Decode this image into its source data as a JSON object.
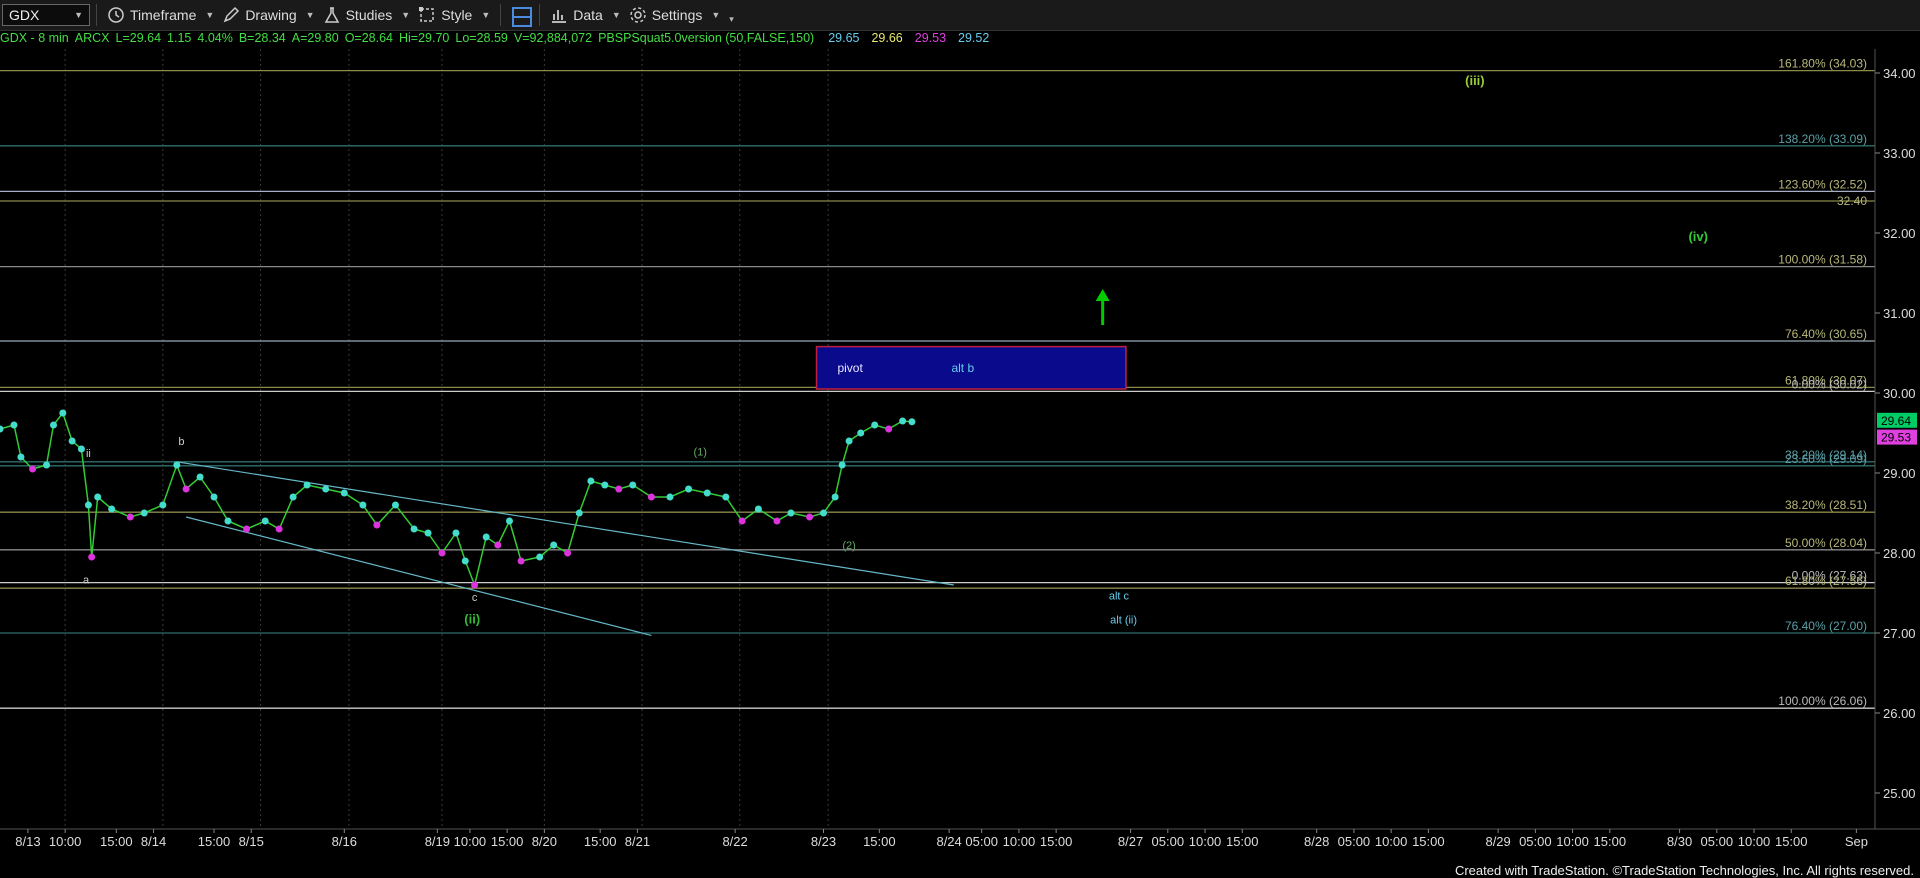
{
  "toolbar": {
    "symbol": "GDX",
    "items": [
      {
        "label": "Timeframe",
        "icon": "clock-icon"
      },
      {
        "label": "Drawing",
        "icon": "pencil-icon"
      },
      {
        "label": "Studies",
        "icon": "flask-icon"
      },
      {
        "label": "Style",
        "icon": "style-icon"
      },
      {
        "label": "",
        "icon": "layout-icon"
      },
      {
        "label": "Data",
        "icon": "bar-chart-icon"
      },
      {
        "label": "Settings",
        "icon": "gear-icon"
      }
    ]
  },
  "infobar": {
    "symbol": "GDX - 8 min",
    "exchange": "ARCX",
    "last": "L=29.64",
    "change": "1.15",
    "change_pct": "4.04%",
    "bid": "B=28.34",
    "ask": "A=29.80",
    "open": "O=28.64",
    "high": "Hi=29.70",
    "low": "Lo=28.59",
    "volume": "V=92,884,072",
    "study": "PBSPSquat5.0version (50,FALSE,150)",
    "study_values": [
      {
        "value": "29.65",
        "color": "#66ccee"
      },
      {
        "value": "29.66",
        "color": "#e8e86a"
      },
      {
        "value": "29.53",
        "color": "#e040e0"
      },
      {
        "value": "29.52",
        "color": "#66ccee"
      }
    ]
  },
  "footer": "Created with TradeStation. ©TradeStation Technologies, Inc. All rights reserved.",
  "chart_data": {
    "type": "line",
    "title": "GDX - 8 min",
    "y_axis": {
      "min": 24.55,
      "max": 34.3,
      "side": "right",
      "ticks": [
        "25.00",
        "26.00",
        "27.00",
        "28.00",
        "29.00",
        "30.00",
        "31.00",
        "32.00",
        "33.00",
        "34.00"
      ]
    },
    "x_axis": {
      "labels": [
        {
          "t": 0.6,
          "label": "8/13"
        },
        {
          "t": 1.4,
          "label": "10:00"
        },
        {
          "t": 2.5,
          "label": "15:00"
        },
        {
          "t": 3.3,
          "label": "8/14"
        },
        {
          "t": 4.6,
          "label": "15:00"
        },
        {
          "t": 5.4,
          "label": "8/15"
        },
        {
          "t": 7.4,
          "label": "8/16"
        },
        {
          "t": 9.4,
          "label": "8/19"
        },
        {
          "t": 10.1,
          "label": "10:00"
        },
        {
          "t": 10.9,
          "label": "15:00"
        },
        {
          "t": 11.7,
          "label": "8/20"
        },
        {
          "t": 12.9,
          "label": "15:00"
        },
        {
          "t": 13.7,
          "label": "8/21"
        },
        {
          "t": 15.8,
          "label": "8/22"
        },
        {
          "t": 17.7,
          "label": "8/23"
        },
        {
          "t": 18.9,
          "label": "15:00"
        },
        {
          "t": 20.4,
          "label": "8/24"
        },
        {
          "t": 21.1,
          "label": "05:00"
        },
        {
          "t": 21.9,
          "label": "10:00"
        },
        {
          "t": 22.7,
          "label": "15:00"
        },
        {
          "t": 24.3,
          "label": "8/27"
        },
        {
          "t": 25.1,
          "label": "05:00"
        },
        {
          "t": 25.9,
          "label": "10:00"
        },
        {
          "t": 26.7,
          "label": "15:00"
        },
        {
          "t": 28.3,
          "label": "8/28"
        },
        {
          "t": 29.1,
          "label": "05:00"
        },
        {
          "t": 29.9,
          "label": "10:00"
        },
        {
          "t": 30.7,
          "label": "15:00"
        },
        {
          "t": 32.2,
          "label": "8/29"
        },
        {
          "t": 33.0,
          "label": "05:00"
        },
        {
          "t": 33.8,
          "label": "10:00"
        },
        {
          "t": 34.6,
          "label": "15:00"
        },
        {
          "t": 36.1,
          "label": "8/30"
        },
        {
          "t": 36.9,
          "label": "05:00"
        },
        {
          "t": 37.7,
          "label": "10:00"
        },
        {
          "t": 38.5,
          "label": "15:00"
        },
        {
          "t": 39.9,
          "label": "Sep"
        }
      ]
    },
    "session_dividers": [
      1.4,
      3.5,
      5.6,
      7.5,
      9.5,
      11.7,
      13.8,
      15.9,
      17.8
    ],
    "price_series": [
      {
        "t": 0.0,
        "v": 29.55
      },
      {
        "t": 0.3,
        "v": 29.6
      },
      {
        "t": 0.45,
        "v": 29.2
      },
      {
        "t": 0.7,
        "v": 29.05
      },
      {
        "t": 1.0,
        "v": 29.1
      },
      {
        "t": 1.15,
        "v": 29.6
      },
      {
        "t": 1.35,
        "v": 29.75
      },
      {
        "t": 1.55,
        "v": 29.4
      },
      {
        "t": 1.75,
        "v": 29.3
      },
      {
        "t": 1.9,
        "v": 28.6
      },
      {
        "t": 1.97,
        "v": 27.95
      },
      {
        "t": 2.1,
        "v": 28.7
      },
      {
        "t": 2.4,
        "v": 28.55
      },
      {
        "t": 2.8,
        "v": 28.45
      },
      {
        "t": 3.1,
        "v": 28.5
      },
      {
        "t": 3.5,
        "v": 28.6
      },
      {
        "t": 3.8,
        "v": 29.1
      },
      {
        "t": 4.0,
        "v": 28.8
      },
      {
        "t": 4.3,
        "v": 28.95
      },
      {
        "t": 4.6,
        "v": 28.7
      },
      {
        "t": 4.9,
        "v": 28.4
      },
      {
        "t": 5.3,
        "v": 28.3
      },
      {
        "t": 5.7,
        "v": 28.4
      },
      {
        "t": 6.0,
        "v": 28.3
      },
      {
        "t": 6.3,
        "v": 28.7
      },
      {
        "t": 6.6,
        "v": 28.85
      },
      {
        "t": 7.0,
        "v": 28.8
      },
      {
        "t": 7.4,
        "v": 28.75
      },
      {
        "t": 7.8,
        "v": 28.6
      },
      {
        "t": 8.1,
        "v": 28.35
      },
      {
        "t": 8.5,
        "v": 28.6
      },
      {
        "t": 8.9,
        "v": 28.3
      },
      {
        "t": 9.2,
        "v": 28.25
      },
      {
        "t": 9.5,
        "v": 28.0
      },
      {
        "t": 9.8,
        "v": 28.25
      },
      {
        "t": 10.0,
        "v": 27.9
      },
      {
        "t": 10.2,
        "v": 27.6
      },
      {
        "t": 10.45,
        "v": 28.2
      },
      {
        "t": 10.7,
        "v": 28.1
      },
      {
        "t": 10.95,
        "v": 28.4
      },
      {
        "t": 11.2,
        "v": 27.9
      },
      {
        "t": 11.6,
        "v": 27.95
      },
      {
        "t": 11.9,
        "v": 28.1
      },
      {
        "t": 12.2,
        "v": 28.0
      },
      {
        "t": 12.45,
        "v": 28.5
      },
      {
        "t": 12.7,
        "v": 28.9
      },
      {
        "t": 13.0,
        "v": 28.85
      },
      {
        "t": 13.3,
        "v": 28.8
      },
      {
        "t": 13.6,
        "v": 28.85
      },
      {
        "t": 14.0,
        "v": 28.7
      },
      {
        "t": 14.4,
        "v": 28.7
      },
      {
        "t": 14.8,
        "v": 28.8
      },
      {
        "t": 15.2,
        "v": 28.75
      },
      {
        "t": 15.6,
        "v": 28.7
      },
      {
        "t": 15.95,
        "v": 28.4
      },
      {
        "t": 16.3,
        "v": 28.55
      },
      {
        "t": 16.7,
        "v": 28.4
      },
      {
        "t": 17.0,
        "v": 28.5
      },
      {
        "t": 17.4,
        "v": 28.45
      },
      {
        "t": 17.7,
        "v": 28.5
      },
      {
        "t": 17.95,
        "v": 28.7
      },
      {
        "t": 18.1,
        "v": 29.1
      },
      {
        "t": 18.25,
        "v": 29.4
      },
      {
        "t": 18.5,
        "v": 29.5
      },
      {
        "t": 18.8,
        "v": 29.6
      },
      {
        "t": 19.1,
        "v": 29.55
      },
      {
        "t": 19.4,
        "v": 29.65
      },
      {
        "t": 19.6,
        "v": 29.64
      }
    ],
    "fib_levels": [
      {
        "label": "161.80% (34.03)",
        "v": 34.03,
        "color": "#8a8a4a"
      },
      {
        "label": "138.20% (33.09)",
        "v": 33.09,
        "color": "#2e6e6e"
      },
      {
        "label": "123.60% (32.52)",
        "v": 32.52,
        "color": "#a8b0c8"
      },
      {
        "label": "100.00% (31.58)",
        "v": 31.58,
        "color": "#8a8a8a"
      },
      {
        "label": "76.40% (30.65)",
        "v": 30.65,
        "color": "#9aaab8"
      },
      {
        "label": "61.80% (30.07)",
        "v": 30.07,
        "color": "#8a8a4a"
      },
      {
        "label": "0.00% (30.02)",
        "v": 30.02,
        "color": "#cccccc"
      },
      {
        "label": "38.20% (29.14)",
        "v": 29.14,
        "color": "#2e6e6e"
      },
      {
        "label": "23.60% (29.09)",
        "v": 29.09,
        "color": "#2e6e6e"
      },
      {
        "label": "38.20% (28.51)",
        "v": 28.51,
        "color": "#8a8a4a"
      },
      {
        "label": "50.00% (28.04)",
        "v": 28.04,
        "color": "#8a8a8a"
      },
      {
        "label": "0.00% (27.63)",
        "v": 27.63,
        "color": "#cccccc"
      },
      {
        "label": "61.80% (27.56)",
        "v": 27.56,
        "color": "#8a8a4a"
      },
      {
        "label": "76.40% (27.00)",
        "v": 27.0,
        "color": "#2e6e6e"
      },
      {
        "label": "100.00% (26.06)",
        "v": 26.06,
        "color": "#cccccc"
      }
    ],
    "extra_level": {
      "label": "32.40",
      "v": 32.4,
      "color": "#8a8a4a"
    },
    "price_tags": [
      {
        "label": "29.64",
        "v": 29.64,
        "bg": "#00cc66",
        "fg": "#000000"
      },
      {
        "label": "29.53",
        "v": 29.53,
        "bg": "#e040e0",
        "fg": "#000000"
      }
    ],
    "pivot_box": {
      "t0": 17.55,
      "t1": 24.2,
      "v0": 30.05,
      "v1": 30.58,
      "labels": [
        {
          "text": "pivot",
          "t": 18.0
        },
        {
          "text": "alt b",
          "t": 20.45
        }
      ]
    },
    "channel_lines": [
      {
        "t0": 3.8,
        "v0": 29.14,
        "t1": 20.5,
        "v1": 27.6
      },
      {
        "t0": 4.0,
        "v0": 28.45,
        "t1": 14.0,
        "v1": 26.97
      }
    ],
    "wave_labels": [
      {
        "text": "a",
        "t": 1.85,
        "v": 27.62,
        "color": "#cccccc"
      },
      {
        "text": "b",
        "t": 3.9,
        "v": 29.35,
        "color": "#cccccc"
      },
      {
        "text": "ii",
        "t": 1.9,
        "v": 29.2,
        "color": "#cccccc"
      },
      {
        "text": "c",
        "t": 10.2,
        "v": 27.4,
        "color": "#cccccc"
      },
      {
        "text": "(ii)",
        "t": 10.15,
        "v": 27.12,
        "color": "#33bb33"
      },
      {
        "text": "(1)",
        "t": 15.05,
        "v": 29.22,
        "color": "#66aa66"
      },
      {
        "text": "(2)",
        "t": 18.25,
        "v": 28.05,
        "color": "#66aa66"
      },
      {
        "text": "(iii)",
        "t": 31.7,
        "v": 33.85,
        "color": "#9acd32"
      },
      {
        "text": "(iv)",
        "t": 36.5,
        "v": 31.9,
        "color": "#33cc33"
      },
      {
        "text": "alt c",
        "t": 24.05,
        "v": 27.42,
        "color": "#66ccee"
      },
      {
        "text": "alt (ii)",
        "t": 24.15,
        "v": 27.12,
        "color": "#66ccee"
      }
    ],
    "up_arrow": {
      "t": 23.7,
      "v0": 30.85,
      "v1": 31.25,
      "color": "#00cc00"
    }
  }
}
